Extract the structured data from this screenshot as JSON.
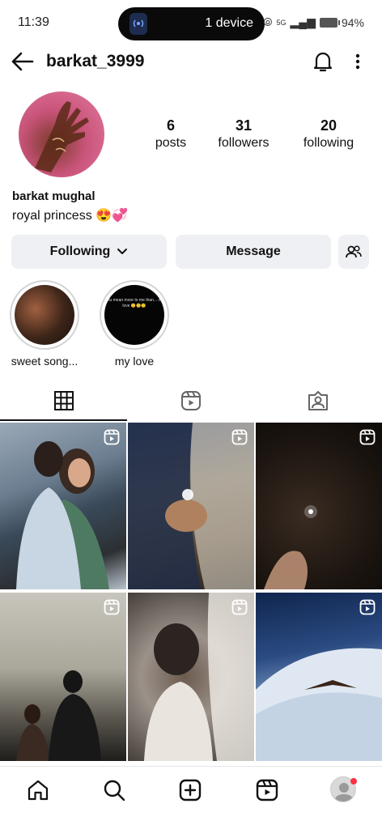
{
  "status_bar": {
    "time": "11:39",
    "device_text": "1 device",
    "network": "5G",
    "battery": "94%"
  },
  "header": {
    "username": "barkat_3999"
  },
  "profile": {
    "stats": [
      {
        "value": "6",
        "label": "posts"
      },
      {
        "value": "31",
        "label": "followers"
      },
      {
        "value": "20",
        "label": "following"
      }
    ],
    "display_name": "barkat mughal",
    "bio": "royal princess 😍💞"
  },
  "actions": {
    "following_label": "Following",
    "message_label": "Message"
  },
  "highlights": [
    {
      "label": "sweet song...",
      "inner_text": ""
    },
    {
      "label": "my love",
      "inner_text": "You mean more to me than... my love 🙂🙂🙂"
    }
  ],
  "tabs": [
    "grid-icon",
    "reels-icon",
    "tagged-icon"
  ],
  "grid_posts": 6,
  "nav": [
    "home-icon",
    "search-icon",
    "create-icon",
    "reels-icon",
    "profile-avatar"
  ],
  "colors": {
    "button_bg": "#eff0f3",
    "notification_dot": "#ff3040"
  }
}
